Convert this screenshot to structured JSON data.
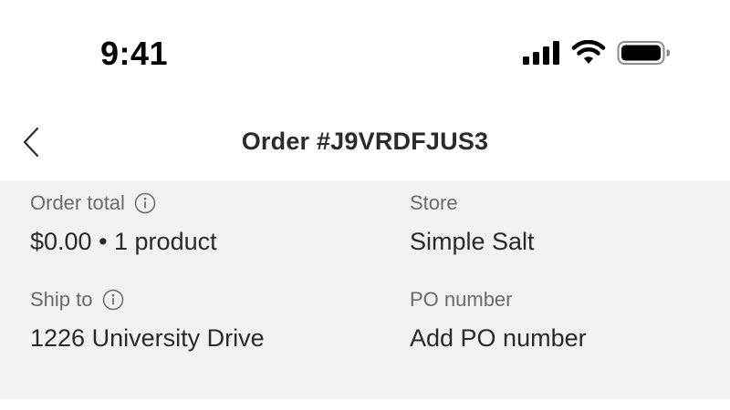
{
  "status_bar": {
    "time": "9:41",
    "icons": [
      "signal-icon",
      "wifi-icon",
      "battery-icon"
    ]
  },
  "header": {
    "back_icon": "chevron-left-icon",
    "title": "Order #J9VRDFJUS3"
  },
  "summary": {
    "order_total": {
      "label": "Order total",
      "value": "$0.00 • 1 product"
    },
    "store": {
      "label": "Store",
      "value": "Simple Salt"
    },
    "ship_to": {
      "label": "Ship to",
      "value": "1226 University Drive"
    },
    "po_number": {
      "label": "PO number",
      "value": "Add PO number"
    }
  },
  "colors": {
    "panel_background": "#f2f2f2",
    "label_text": "#6a6a6a",
    "value_text": "#2a2a2a"
  }
}
